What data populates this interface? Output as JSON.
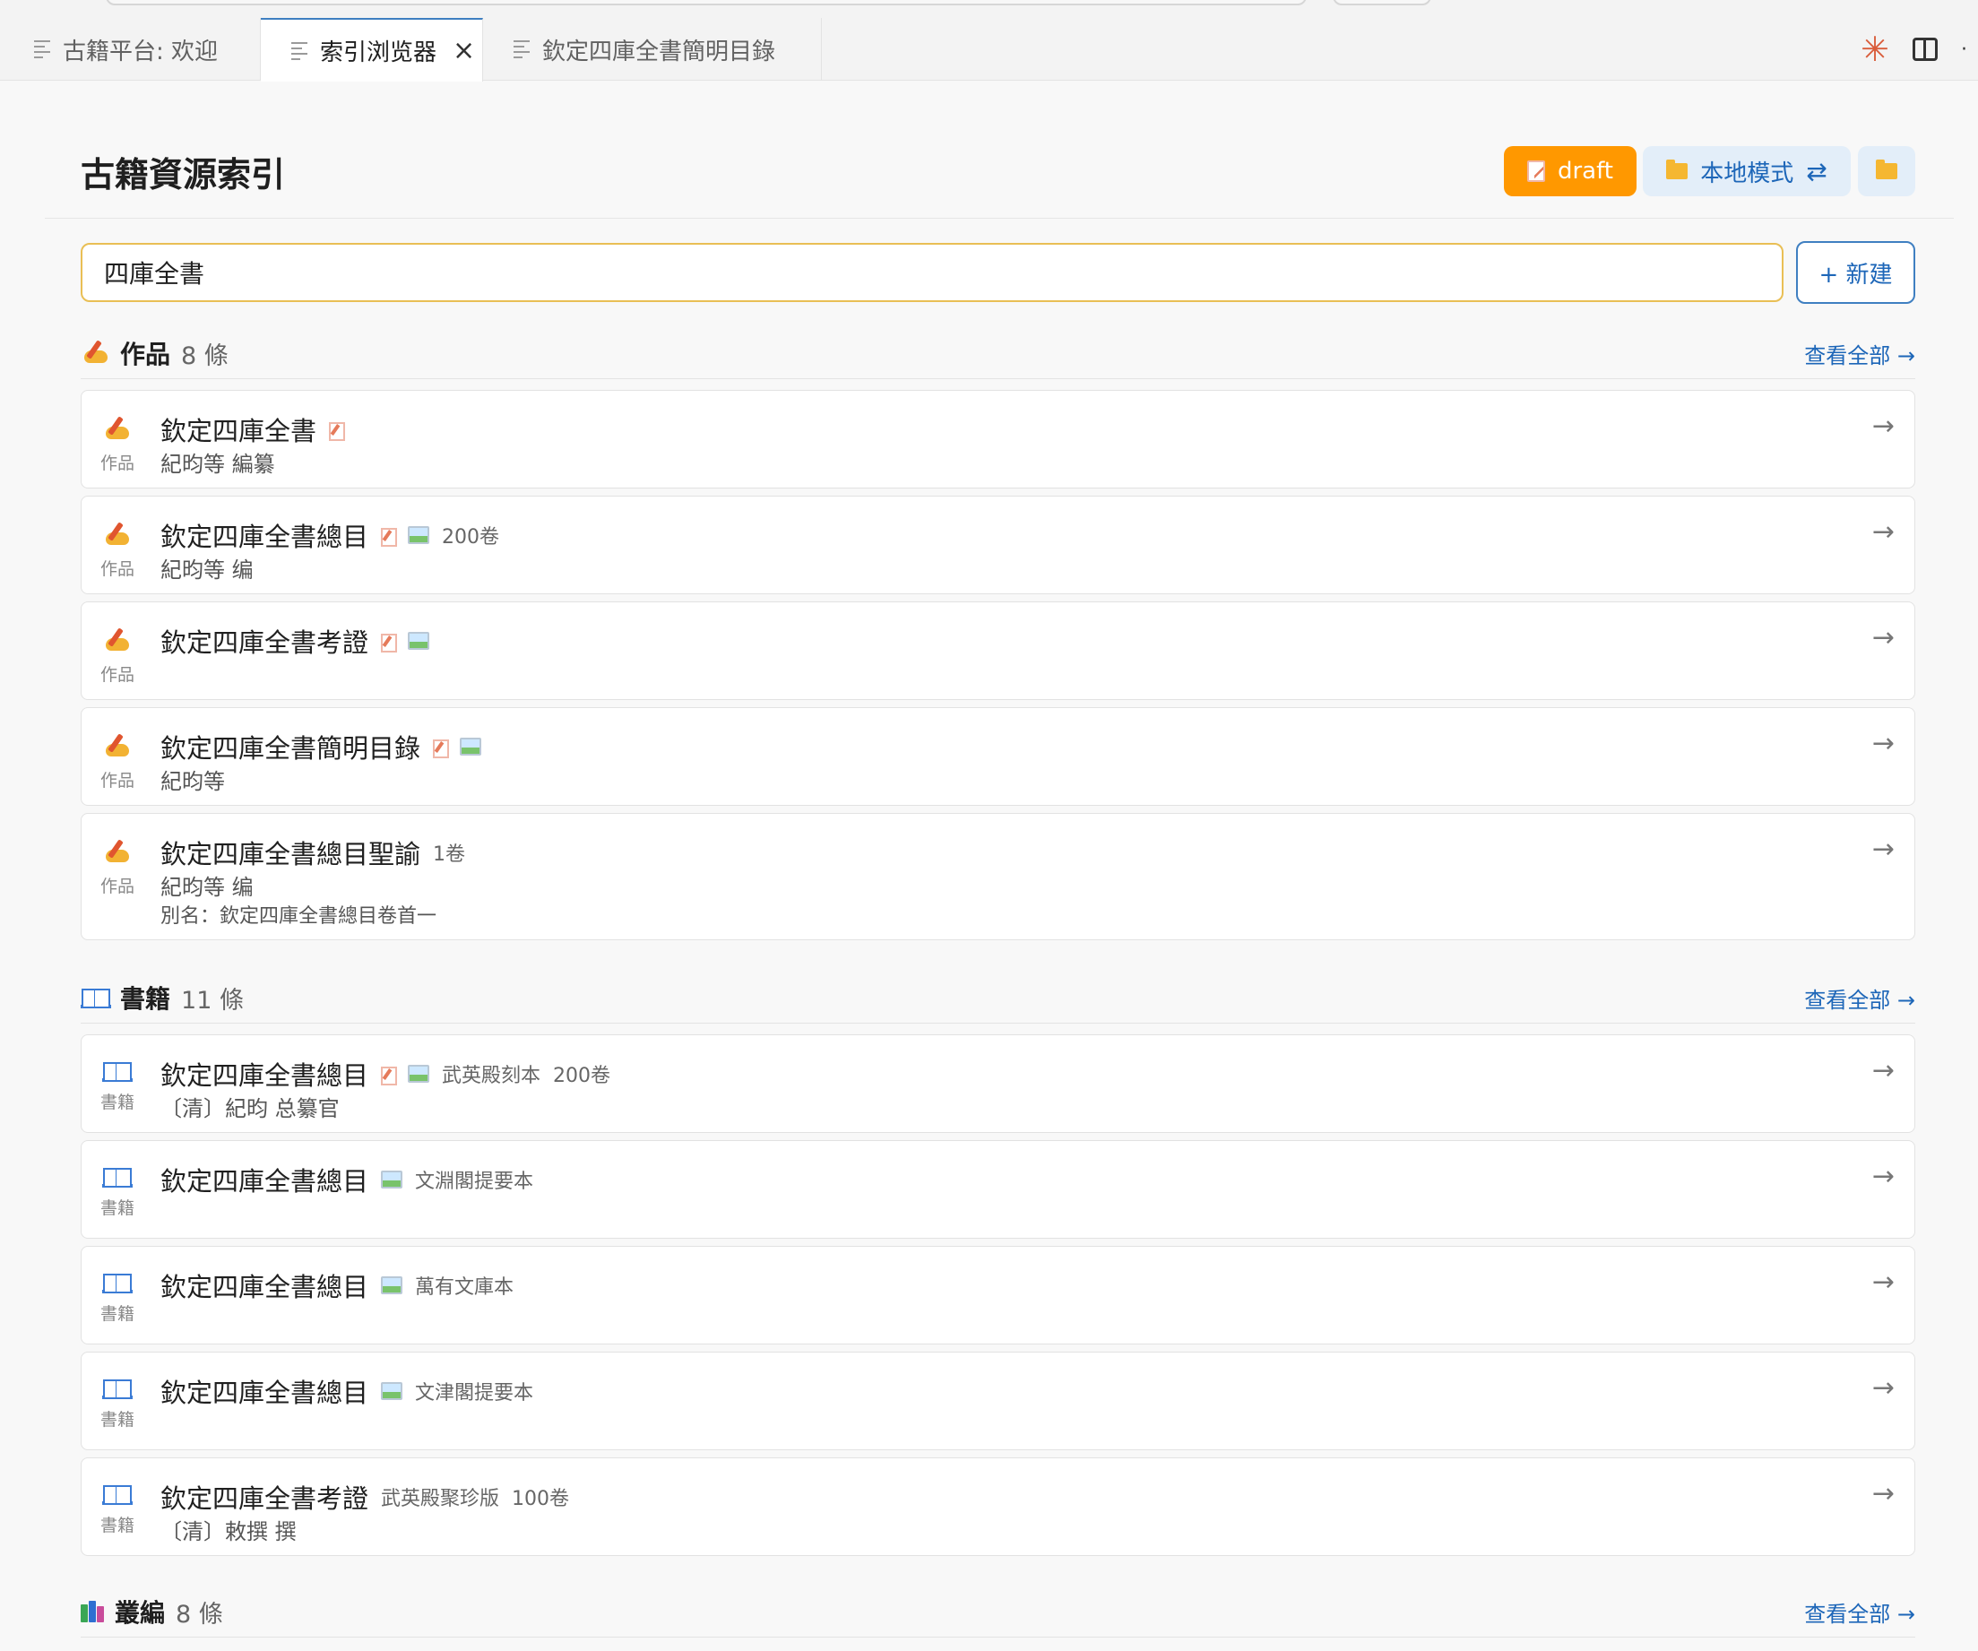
{
  "tabs": [
    {
      "label": "古籍平台: 欢迎"
    },
    {
      "label": "索引浏览器",
      "close": "×"
    },
    {
      "label": "欽定四庫全書簡明目錄"
    }
  ],
  "header": {
    "title": "古籍資源索引",
    "draft_label": "draft",
    "mode_label": "本地模式",
    "swap_glyph": "⇄"
  },
  "search": {
    "value": "四庫全書",
    "new_label": "+ 新建"
  },
  "sections": {
    "works": {
      "name": "作品",
      "count": "8 條",
      "view_all": "查看全部 →",
      "items": [
        {
          "title": "欽定四庫全書",
          "type": "作品",
          "sub1": "紀昀等 編纂",
          "arrow": "→"
        },
        {
          "title": "欽定四庫全書總目",
          "type": "作品",
          "meta": "200卷",
          "sub1": "紀昀等 编",
          "arrow": "→"
        },
        {
          "title": "欽定四庫全書考證",
          "type": "作品",
          "arrow": "→"
        },
        {
          "title": "欽定四庫全書簡明目錄",
          "type": "作品",
          "sub1": "紀昀等",
          "arrow": "→"
        },
        {
          "title": "欽定四庫全書總目聖諭",
          "type": "作品",
          "meta": "1卷",
          "sub1": "紀昀等 编",
          "sub2": "別名：欽定四庫全書總目卷首一",
          "arrow": "→"
        }
      ]
    },
    "books": {
      "name": "書籍",
      "count": "11 條",
      "view_all": "查看全部 →",
      "items": [
        {
          "title": "欽定四庫全書總目",
          "type": "書籍",
          "edition": "武英殿刻本",
          "meta": "200卷",
          "sub1": "〔清〕紀昀 总纂官",
          "arrow": "→"
        },
        {
          "title": "欽定四庫全書總目",
          "type": "書籍",
          "edition": "文淵閣提要本",
          "arrow": "→"
        },
        {
          "title": "欽定四庫全書總目",
          "type": "書籍",
          "edition": "萬有文庫本",
          "arrow": "→"
        },
        {
          "title": "欽定四庫全書總目",
          "type": "書籍",
          "edition": "文津閣提要本",
          "arrow": "→"
        },
        {
          "title": "欽定四庫全書考證",
          "type": "書籍",
          "edition": "武英殿聚珍版",
          "meta": "100卷",
          "sub1": "〔清〕敕撰 撰",
          "arrow": "→"
        }
      ]
    },
    "collections": {
      "name": "叢編",
      "count": "8 條",
      "view_all": "查看全部 →"
    }
  },
  "colors": {
    "accent": "#1d66b8",
    "draft": "#ff9800",
    "search_border": "#e9bf55"
  },
  "icons": [
    "file-icon",
    "close-icon",
    "spark-icon",
    "split-editor-icon",
    "draft-doc-icon",
    "folder-icon",
    "swap-icon",
    "pen-icon",
    "book-icon",
    "books-icon",
    "image-icon",
    "arrow-right-icon"
  ]
}
